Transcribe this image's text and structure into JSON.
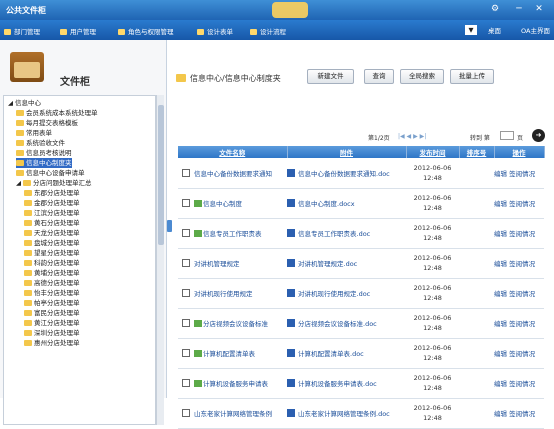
{
  "window": {
    "title": "公共文件柜"
  },
  "menu": {
    "items": [
      "部门管理",
      "用户管理",
      "角色与权限管理",
      "设计表单",
      "设计流程"
    ],
    "right": [
      "桌面",
      "OA主界面"
    ]
  },
  "left": {
    "title": "文件柜",
    "tree": [
      {
        "label": "信息中心",
        "level": 0,
        "expander": "◢",
        "folder": false
      },
      {
        "label": "会员系统成本系统处理单",
        "level": 1,
        "folder": true
      },
      {
        "label": "每月提交表格模板",
        "level": 1,
        "folder": true
      },
      {
        "label": "常用表单",
        "level": 1,
        "folder": true
      },
      {
        "label": "系统验收文件",
        "level": 1,
        "folder": true
      },
      {
        "label": "信息员考核说明",
        "level": 1,
        "folder": true
      },
      {
        "label": "信息中心制度夹",
        "level": 1,
        "folder": true,
        "selected": true
      },
      {
        "label": "信息中心设备申请单",
        "level": 1,
        "folder": true
      },
      {
        "label": "分店问题处理单汇总",
        "level": 1,
        "expander": "◢",
        "folder": true
      },
      {
        "label": "东郡分店处理单",
        "level": 2,
        "folder": true
      },
      {
        "label": "金郡分店处理单",
        "level": 2,
        "folder": true
      },
      {
        "label": "江滨分店处理单",
        "level": 2,
        "folder": true
      },
      {
        "label": "黄石分店处理单",
        "level": 2,
        "folder": true
      },
      {
        "label": "天龙分店处理单",
        "level": 2,
        "folder": true
      },
      {
        "label": "盘城分店处理单",
        "level": 2,
        "folder": true
      },
      {
        "label": "望星分店处理单",
        "level": 2,
        "folder": true
      },
      {
        "label": "科韵分店处理单",
        "level": 2,
        "folder": true
      },
      {
        "label": "黄埔分店处理单",
        "level": 2,
        "folder": true
      },
      {
        "label": "高德分店处理单",
        "level": 2,
        "folder": true
      },
      {
        "label": "怡丰分店处理单",
        "level": 2,
        "folder": true
      },
      {
        "label": "帕亭分店处理单",
        "level": 2,
        "folder": true
      },
      {
        "label": "富民分店处理单",
        "level": 2,
        "folder": true
      },
      {
        "label": "黄江分店处理单",
        "level": 2,
        "folder": true
      },
      {
        "label": "深圳分店处理单",
        "level": 2,
        "folder": true
      },
      {
        "label": "惠州分店处理单",
        "level": 2,
        "folder": true
      }
    ]
  },
  "main": {
    "folder_path": "信息中心/信息中心制度夹",
    "buttons": [
      "新建文件",
      "查询",
      "全局搜索",
      "批量上传"
    ],
    "pager": {
      "info": "第1/2页",
      "nav": "|◀  ◀  ▶  ▶|",
      "goto_label": "转到 第",
      "page_unit": "页"
    },
    "columns": [
      "文件名称",
      "附件",
      "发布时间",
      "排序号",
      "操作"
    ],
    "rows": [
      {
        "name": "信息中心备份数据要求通知",
        "image": false,
        "attachment": "信息中心备份数据要求通知.doc",
        "date": "2012-06-06",
        "time": "12:48",
        "ops": "编辑 签阅情况"
      },
      {
        "name": "信息中心制度",
        "image": true,
        "attachment": "信息中心制度.docx",
        "date": "2012-06-06",
        "time": "12:48",
        "ops": "编辑 签阅情况"
      },
      {
        "name": "信息专员工作职责表",
        "image": true,
        "attachment": "信息专员工作职责表.doc",
        "date": "2012-06-06",
        "time": "12:48",
        "ops": "编辑 签阅情况"
      },
      {
        "name": "对讲机管理规定",
        "image": false,
        "attachment": "对讲机管理规定.doc",
        "date": "2012-06-06",
        "time": "12:48",
        "ops": "编辑 签阅情况"
      },
      {
        "name": "对讲机现行使用规定",
        "image": false,
        "attachment": "对讲机现行使用规定.doc",
        "date": "2012-06-06",
        "time": "12:48",
        "ops": "编辑 签阅情况"
      },
      {
        "name": "分店视频会议设备标准",
        "image": true,
        "attachment": "分店视频会议设备标准.doc",
        "date": "2012-06-06",
        "time": "12:48",
        "ops": "编辑 签阅情况"
      },
      {
        "name": "计算机配置清单表",
        "image": true,
        "attachment": "计算机配置清单表.doc",
        "date": "2012-06-06",
        "time": "12:48",
        "ops": "编辑 签阅情况"
      },
      {
        "name": "计算机设备服务申请表",
        "image": true,
        "attachment": "计算机设备服务申请表.doc",
        "date": "2012-06-06",
        "time": "12:48",
        "ops": "编辑 签阅情况"
      },
      {
        "name": "山东老家计算网络管理条例",
        "image": false,
        "attachment": "山东老家计算网络管理条例.doc",
        "date": "2012-06-06",
        "time": "12:48",
        "ops": "编辑 签阅情况"
      }
    ]
  }
}
